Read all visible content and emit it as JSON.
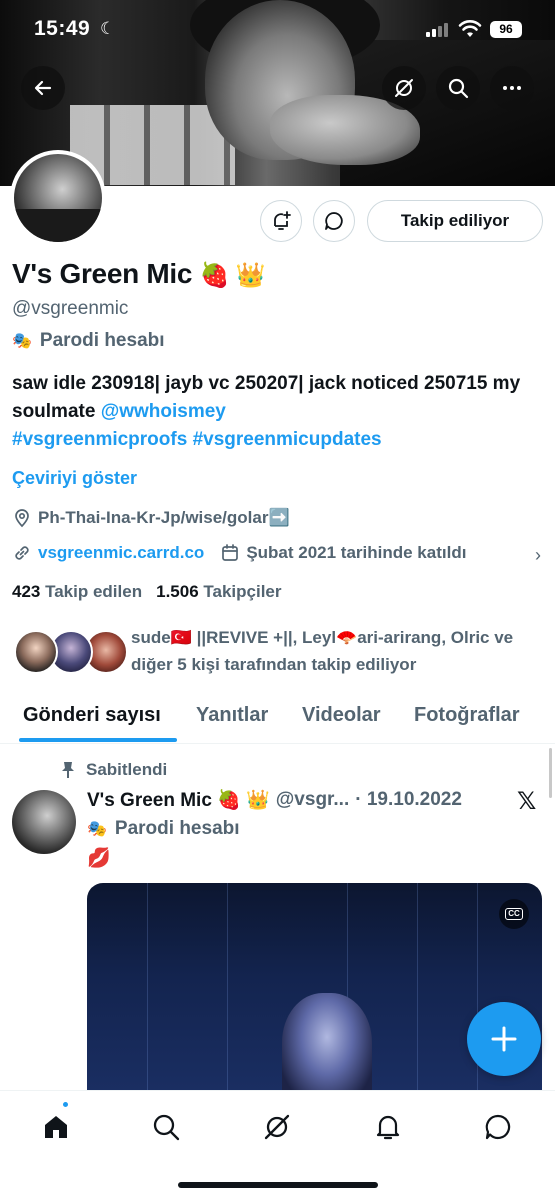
{
  "status_bar": {
    "time": "15:49",
    "battery": "96"
  },
  "profile": {
    "name": "V's Green Mic",
    "name_emojis": "🍓 👑",
    "handle": "@vsgreenmic",
    "parody_label": "Parodi hesabı",
    "bio_text": "saw idle 230918| jayb vc 250207| jack noticed 250715 my soulmate ",
    "bio_mention": "@wwhoismey",
    "bio_hashtags": "#vsgreenmicproofs #vsgreenmicupdates",
    "translate_label": "Çeviriyi göster",
    "location": "Ph-Thai-Ina-Kr-Jp/wise/golar➡️",
    "website": "vsgreenmic.carrd.co",
    "joined": "Şubat 2021 tarihinde katıldı",
    "following_count": "423",
    "following_label": "Takip edilen",
    "followers_count": "1.506",
    "followers_label": "Takipçiler",
    "followed_by": "sude🇹🇷 ||REVIVE +||, Leyl🪭ari-arirang, Olric ve diğer 5 kişi tarafından takip ediliyor"
  },
  "actions": {
    "follow_button": "Takip ediliyor"
  },
  "tabs": [
    "Gönderi sayısı",
    "Yanıtlar",
    "Videolar",
    "Fotoğraflar"
  ],
  "pinned_post": {
    "pinned_label": "Sabitlendi",
    "author_name": "V's Green Mic 🍓 👑",
    "author_handle": "@vsgr...",
    "date": "· 19.10.2022",
    "parody_label": "Parodi hesabı",
    "text": "💋"
  },
  "colors": {
    "accent": "#1d9bf0",
    "text": "#0f1419",
    "muted": "#536471"
  },
  "icons": [
    "back-arrow-icon",
    "grok-icon",
    "search-icon",
    "more-icon",
    "bell-plus-icon",
    "message-icon",
    "location-icon",
    "link-icon",
    "calendar-icon",
    "pin-icon",
    "x-logo-icon",
    "closed-captions-icon",
    "home-icon",
    "explore-icon",
    "notifications-icon",
    "messages-icon"
  ]
}
